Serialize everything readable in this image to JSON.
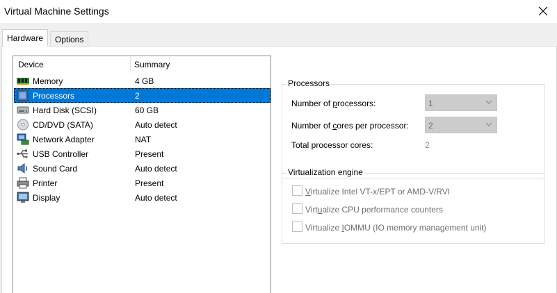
{
  "window": {
    "title": "Virtual Machine Settings"
  },
  "tabs": [
    {
      "label": "Hardware"
    },
    {
      "label": "Options"
    }
  ],
  "device_list": {
    "headers": {
      "device": "Device",
      "summary": "Summary"
    },
    "rows": [
      {
        "device": "Memory",
        "summary": "4 GB",
        "icon": "memory-icon"
      },
      {
        "device": "Processors",
        "summary": "2",
        "icon": "processor-icon",
        "selected": true
      },
      {
        "device": "Hard Disk (SCSI)",
        "summary": "60 GB",
        "icon": "hard-disk-icon"
      },
      {
        "device": "CD/DVD (SATA)",
        "summary": "Auto detect",
        "icon": "cd-dvd-icon"
      },
      {
        "device": "Network Adapter",
        "summary": "NAT",
        "icon": "network-adapter-icon"
      },
      {
        "device": "USB Controller",
        "summary": "Present",
        "icon": "usb-icon"
      },
      {
        "device": "Sound Card",
        "summary": "Auto detect",
        "icon": "speaker-icon"
      },
      {
        "device": "Printer",
        "summary": "Present",
        "icon": "printer-icon"
      },
      {
        "device": "Display",
        "summary": "Auto detect",
        "icon": "display-icon"
      }
    ]
  },
  "processors": {
    "group_title": "Processors",
    "num_processors": {
      "pre": "Number of ",
      "key": "p",
      "post": "rocessors:",
      "value": "1"
    },
    "cores_per_processor": {
      "pre": "Number of ",
      "key": "c",
      "post": "ores per processor:",
      "value": "2"
    },
    "total_cores": {
      "label": "Total processor cores:",
      "value": "2"
    }
  },
  "virtualization": {
    "group_title": "Virtualization engine",
    "options": [
      {
        "pre": "",
        "key": "V",
        "post": "irtualize Intel VT-x/EPT or AMD-V/RVI",
        "checked": false
      },
      {
        "pre": "Virt",
        "key": "u",
        "post": "alize CPU performance counters",
        "checked": false
      },
      {
        "pre": "Virtualize ",
        "key": "I",
        "post": "OMMU (IO memory management unit)",
        "checked": false
      }
    ]
  },
  "colors": {
    "selection": "#0078d7",
    "window_bg": "#f0f0f0",
    "disabled_text": "#6d6d6d"
  }
}
